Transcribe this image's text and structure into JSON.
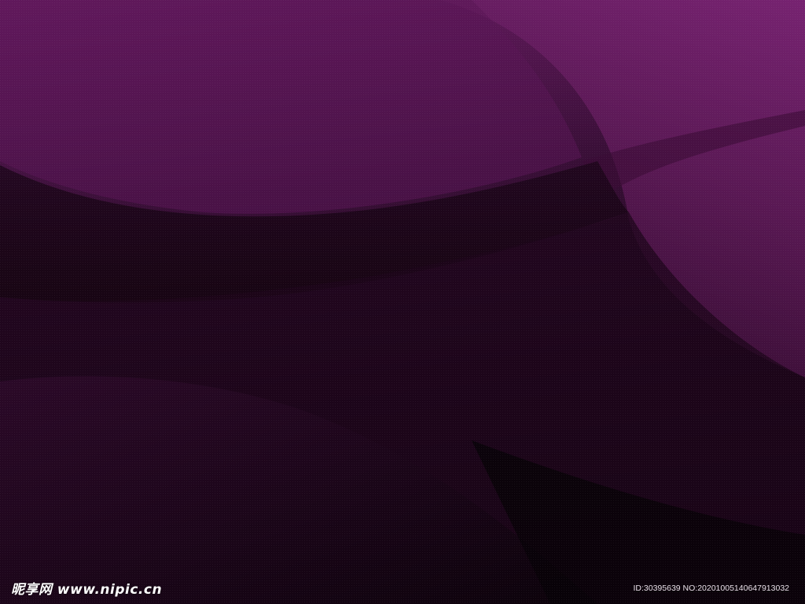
{
  "background": {
    "colors": {
      "top": "#6a1c64",
      "upper_right": "#7a2474",
      "middle": "#2a0a28",
      "bottom": "#0e030d",
      "accent": "#5a1656"
    }
  },
  "watermark": {
    "logo_text": "昵享网 www.nipic.cn",
    "id_text": "ID:30395639 NO:20201005140647913032"
  }
}
